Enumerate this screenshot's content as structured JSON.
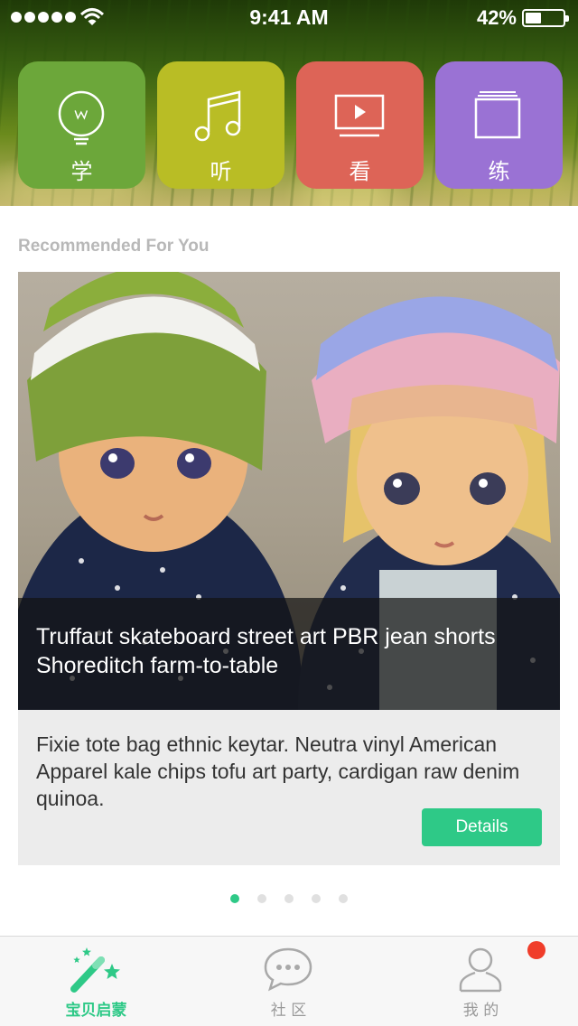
{
  "status_bar": {
    "time": "9:41 AM",
    "battery_percent": "42%",
    "battery_level": 0.42
  },
  "categories": [
    {
      "label": "学",
      "icon": "lightbulb-icon",
      "color": "#6ca73a"
    },
    {
      "label": "听",
      "icon": "music-note-icon",
      "color": "#b9bd25"
    },
    {
      "label": "看",
      "icon": "tv-play-icon",
      "color": "#dd6457"
    },
    {
      "label": "练",
      "icon": "book-icon",
      "color": "#9a72d4"
    }
  ],
  "section": {
    "title": "Recommended For You"
  },
  "card": {
    "title": "Truffaut skateboard street art PBR jean shorts Shoreditch farm-to-table",
    "description": "Fixie tote bag ethnic keytar. Neutra vinyl American Apparel kale chips tofu art party, cardigan raw denim quinoa.",
    "details_label": "Details"
  },
  "pager": {
    "count": 5,
    "active": 0
  },
  "tab_bar": {
    "tabs": [
      {
        "label": "宝贝启蒙",
        "icon": "magic-wand-icon",
        "active": true
      },
      {
        "label": "社 区",
        "icon": "chat-bubble-icon",
        "active": false
      },
      {
        "label": "我 的",
        "icon": "user-icon",
        "active": false
      }
    ]
  },
  "colors": {
    "accent": "#2ec987",
    "notification": "#f03d2a"
  }
}
